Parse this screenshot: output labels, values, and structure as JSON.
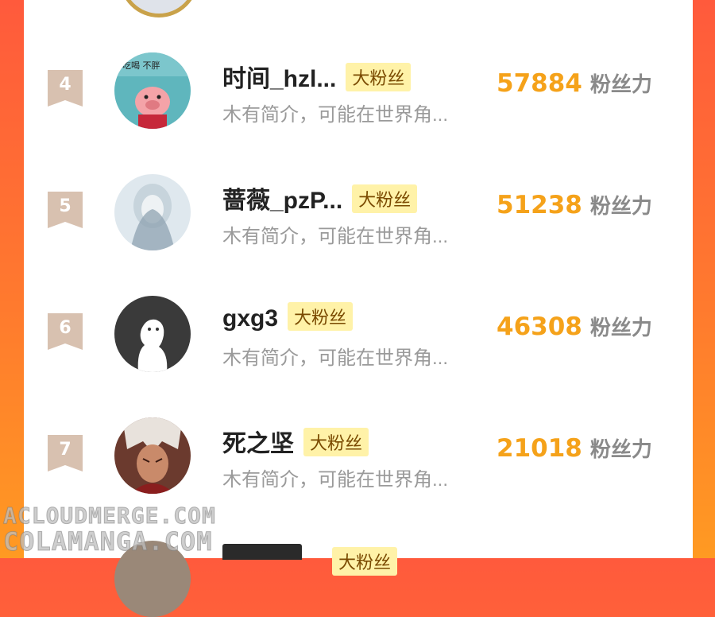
{
  "entries": [
    {
      "rank": "4",
      "name": "时间_hzl...",
      "badge": "大粉丝",
      "bio": "木有简介，可能在世界角...",
      "score": "57884",
      "unit": "粉丝力"
    },
    {
      "rank": "5",
      "name": "蔷薇_pzP...",
      "badge": "大粉丝",
      "bio": "木有简介，可能在世界角...",
      "score": "51238",
      "unit": "粉丝力"
    },
    {
      "rank": "6",
      "name": "gxg3",
      "badge": "大粉丝",
      "bio": "木有简介，可能在世界角...",
      "score": "46308",
      "unit": "粉丝力"
    },
    {
      "rank": "7",
      "name": "死之坚",
      "badge": "大粉丝",
      "bio": "木有简介，可能在世界角...",
      "score": "21018",
      "unit": "粉丝力"
    }
  ],
  "next_badge": "大粉丝",
  "watermark": {
    "line1": "ACLOUDMERGE.COM",
    "line2": "COLAMANGA.COM"
  },
  "avatar_text": {
    "pig_caption": "吃喝 不胖"
  },
  "colors": {
    "accent_gold": "#f5a21a",
    "badge_bg": "#fff2a8",
    "rank_flag": "#d8c1b0",
    "bg_gradient_start": "#ff5a3c",
    "bg_gradient_end": "#ff9a22"
  }
}
